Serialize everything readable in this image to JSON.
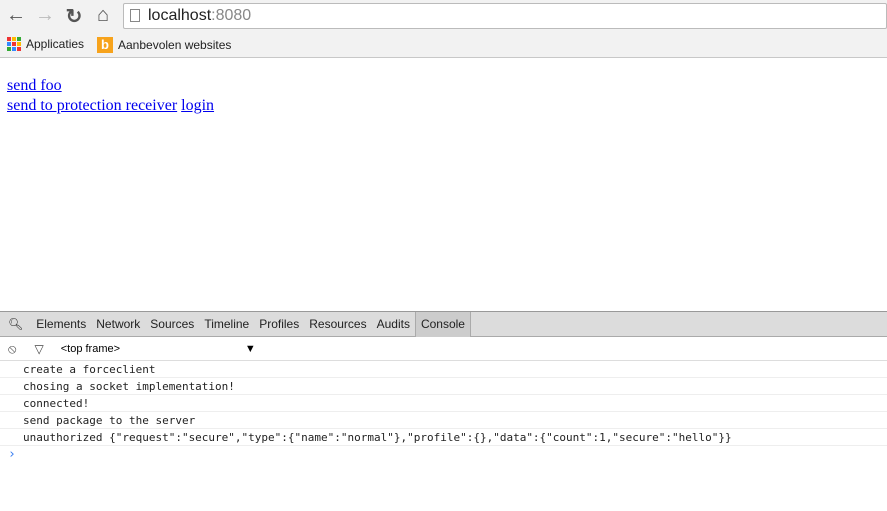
{
  "browser": {
    "url_host": "localhost",
    "url_port": ":8080",
    "bookmarks": [
      {
        "label": "Applicaties",
        "icon": "apps-grid-icon"
      },
      {
        "label": "Aanbevolen websites",
        "icon": "bing-icon"
      }
    ]
  },
  "page": {
    "links": [
      "send foo",
      "send to protection receiver",
      "login"
    ]
  },
  "devtools": {
    "tabs": [
      "Elements",
      "Network",
      "Sources",
      "Timeline",
      "Profiles",
      "Resources",
      "Audits",
      "Console"
    ],
    "active_tab": "Console",
    "frame_select": "<top frame>",
    "console_lines": [
      "create a forceclient",
      "chosing a socket implementation!",
      "connected!",
      "send package to the server",
      "unauthorized {\"request\":\"secure\",\"type\":{\"name\":\"normal\"},\"profile\":{},\"data\":{\"count\":1,\"secure\":\"hello\"}}"
    ],
    "prompt": "›"
  }
}
